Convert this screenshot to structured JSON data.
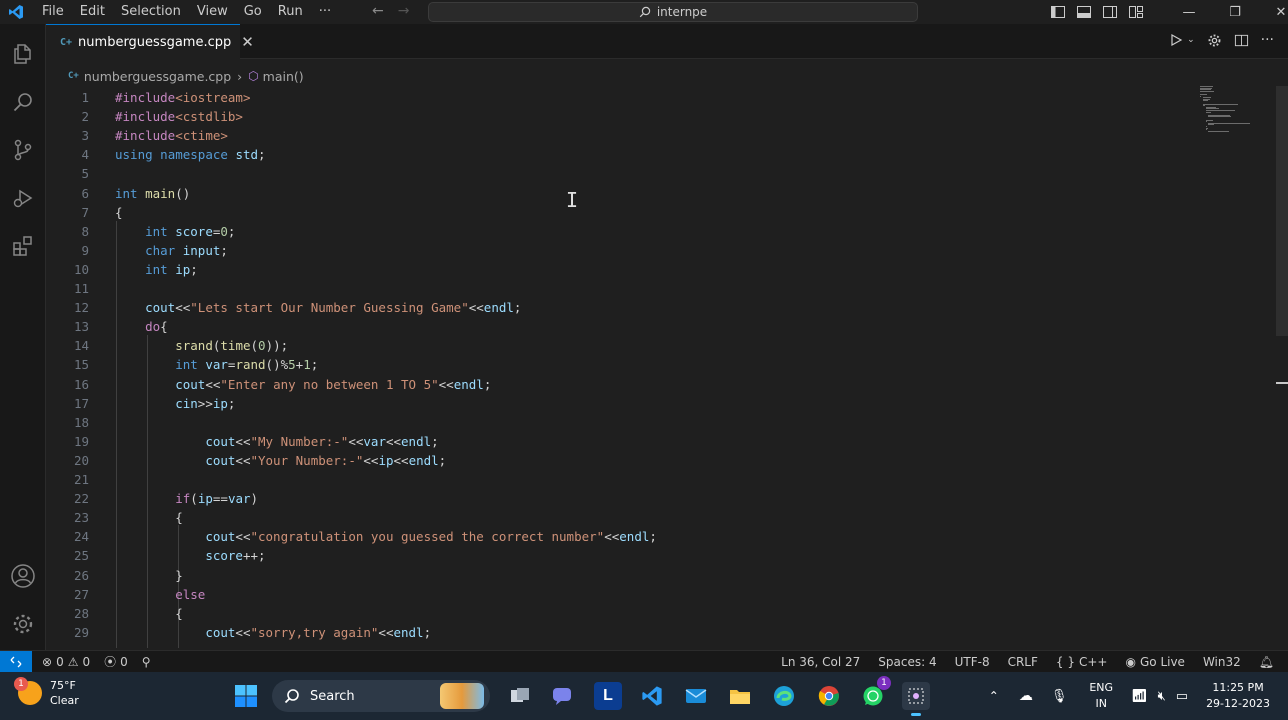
{
  "titlebar": {
    "menu": [
      "File",
      "Edit",
      "Selection",
      "View",
      "Go",
      "Run",
      "···"
    ],
    "search_text": "internpe"
  },
  "tab": {
    "filename": "numberguessgame.cpp",
    "icon_text": "C+"
  },
  "breadcrumb": {
    "file": "numberguessgame.cpp",
    "symbol": "main()"
  },
  "code_lines": [
    {
      "n": "1",
      "text": "#include<iostream>"
    },
    {
      "n": "2",
      "text": "#include<cstdlib>"
    },
    {
      "n": "3",
      "text": "#include<ctime>"
    },
    {
      "n": "4",
      "text": "using namespace std;"
    },
    {
      "n": "5",
      "text": ""
    },
    {
      "n": "6",
      "text": "int main()"
    },
    {
      "n": "7",
      "text": "{"
    },
    {
      "n": "8",
      "text": "    int score=0;"
    },
    {
      "n": "9",
      "text": "    char input;"
    },
    {
      "n": "10",
      "text": "    int ip;"
    },
    {
      "n": "11",
      "text": ""
    },
    {
      "n": "12",
      "text": "    cout<<\"Lets start Our Number Guessing Game\"<<endl;"
    },
    {
      "n": "13",
      "text": "    do{"
    },
    {
      "n": "14",
      "text": "        srand(time(0));"
    },
    {
      "n": "15",
      "text": "        int var=rand()%5+1;"
    },
    {
      "n": "16",
      "text": "        cout<<\"Enter any no between 1 TO 5\"<<endl;"
    },
    {
      "n": "17",
      "text": "        cin>>ip;"
    },
    {
      "n": "18",
      "text": ""
    },
    {
      "n": "19",
      "text": "            cout<<\"My Number:-\"<<var<<endl;"
    },
    {
      "n": "20",
      "text": "            cout<<\"Your Number:-\"<<ip<<endl;"
    },
    {
      "n": "21",
      "text": ""
    },
    {
      "n": "22",
      "text": "        if(ip==var)"
    },
    {
      "n": "23",
      "text": "        {"
    },
    {
      "n": "24",
      "text": "            cout<<\"congratulation you guessed the correct number\"<<endl;"
    },
    {
      "n": "25",
      "text": "            score++;"
    },
    {
      "n": "26",
      "text": "        }"
    },
    {
      "n": "27",
      "text": "        else"
    },
    {
      "n": "28",
      "text": "        {"
    },
    {
      "n": "29",
      "text": "            cout<<\"sorry,try again\"<<endl;"
    }
  ],
  "statusbar": {
    "errors": "0",
    "warnings": "0",
    "ports": "0",
    "position": "Ln 36, Col 27",
    "spaces": "Spaces: 4",
    "encoding": "UTF-8",
    "eol": "CRLF",
    "language": "C++",
    "golive": "Go Live",
    "platform": "Win32"
  },
  "taskbar": {
    "temperature": "75°F",
    "condition": "Clear",
    "weather_badge": "1",
    "search_label": "Search",
    "whatsapp_badge": "1",
    "lang_top": "ENG",
    "lang_bottom": "IN",
    "time": "11:25 PM",
    "date": "29-12-2023"
  },
  "colors": {
    "accent": "#0078d4",
    "keyword": "#569cd6",
    "control": "#c586c0",
    "string": "#ce9178",
    "function": "#dcdcaa",
    "variable": "#9cdcfe",
    "number": "#b5cea8",
    "preprocessor": "#c586c0"
  }
}
